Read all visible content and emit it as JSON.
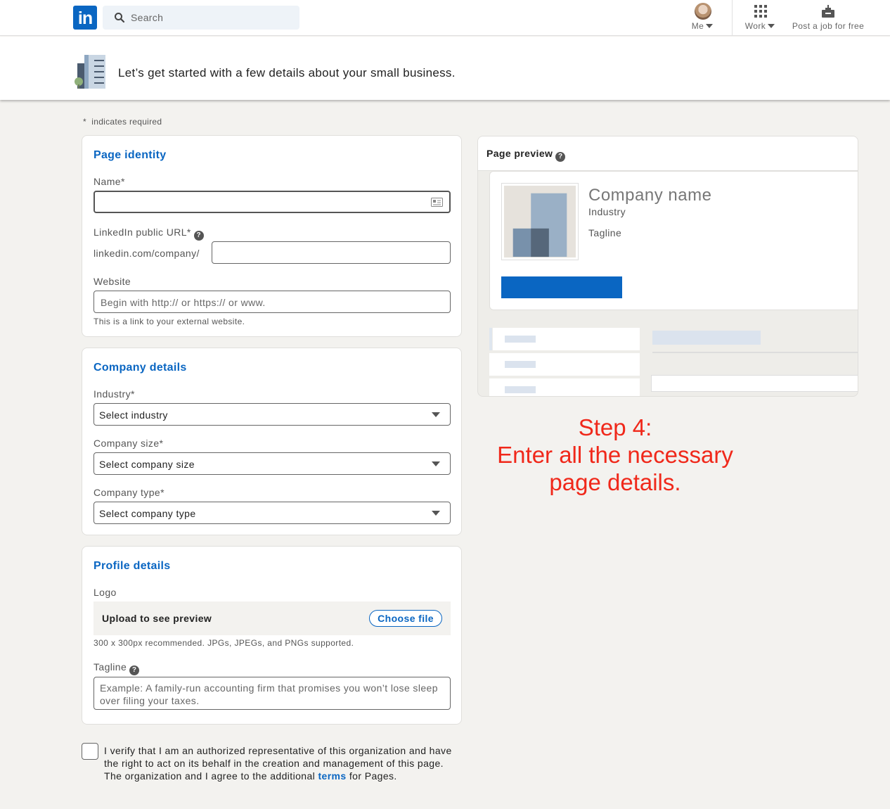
{
  "nav": {
    "logo_text": "in",
    "search_placeholder": "Search",
    "me_label": "Me",
    "work_label": "Work",
    "post_job_label": "Post a job for free",
    "colors": {
      "brand": "#0a66c2"
    }
  },
  "header": {
    "title": "Let’s get started with a few details about your small business."
  },
  "form": {
    "required_note": "indicates required",
    "page_identity": {
      "title": "Page identity",
      "name_label": "Name*",
      "name_value": "",
      "url_label": "LinkedIn public URL*",
      "url_prefix": "linkedin.com/company/",
      "url_value": "",
      "website_label": "Website",
      "website_placeholder": "Begin with http:// or https:// or www.",
      "website_hint": "This is a link to your external website."
    },
    "company_details": {
      "title": "Company details",
      "industry_label": "Industry*",
      "industry_value": "Select industry",
      "size_label": "Company size*",
      "size_value": "Select company size",
      "type_label": "Company type*",
      "type_value": "Select company type"
    },
    "profile_details": {
      "title": "Profile details",
      "logo_label": "Logo",
      "upload_text": "Upload to see preview",
      "choose_file_label": "Choose file",
      "logo_hint": "300 x 300px recommended. JPGs, JPEGs, and PNGs supported.",
      "tagline_label": "Tagline",
      "tagline_placeholder": "Example: A family-run accounting firm that promises you won’t lose sleep over filing your taxes."
    },
    "verify": {
      "text_before": "I verify that I am an authorized representative of this organization and have the right to act on its behalf in the creation and management of this page. The organization and I agree to the additional ",
      "link_text": "terms",
      "text_after": " for Pages.",
      "checked": false
    }
  },
  "preview": {
    "title": "Page preview",
    "company_name": "Company name",
    "industry": "Industry",
    "tagline": "Tagline"
  },
  "annotation": {
    "line1": "Step 4:",
    "line2": "Enter all the necessary page details.",
    "color": "#f0281a"
  }
}
